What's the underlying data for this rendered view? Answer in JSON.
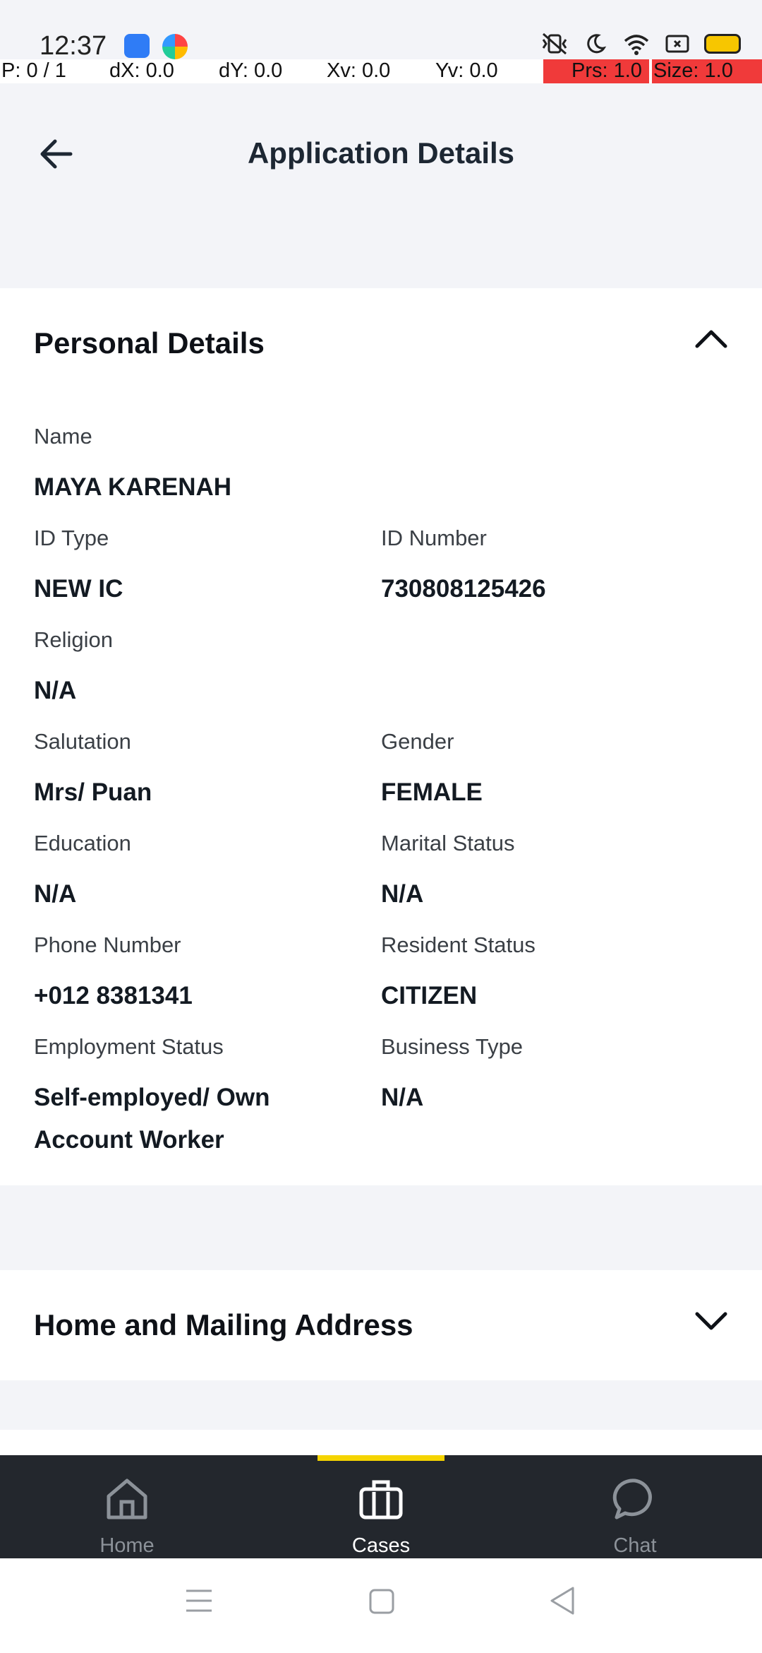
{
  "status_bar": {
    "time": "12:37",
    "icons": [
      "android-app-icon",
      "browser-app-icon",
      "vibrate-icon",
      "moon-icon",
      "wifi-icon",
      "screen-icon",
      "battery-icon"
    ]
  },
  "debug": {
    "pointer": "P: 0 / 1",
    "dx": "dX: 0.0",
    "dy": "dY: 0.0",
    "xv": "Xv: 0.0",
    "yv": "Yv: 0.0",
    "prs": "Prs: 1.0",
    "size": "Size: 1.0"
  },
  "header": {
    "title": "Application Details",
    "back_icon": "arrow-left-icon"
  },
  "personal": {
    "title": "Personal Details",
    "name": {
      "label": "Name",
      "value": "MAYA KARENAH"
    },
    "id_type": {
      "label": "ID Type",
      "value": "NEW IC"
    },
    "id_number": {
      "label": "ID Number",
      "value": "730808125426"
    },
    "religion": {
      "label": "Religion",
      "value": "N/A"
    },
    "salutation": {
      "label": "Salutation",
      "value": "Mrs/ Puan"
    },
    "gender": {
      "label": "Gender",
      "value": "FEMALE"
    },
    "education": {
      "label": "Education",
      "value": "N/A"
    },
    "marital": {
      "label": "Marital Status",
      "value": "N/A"
    },
    "phone": {
      "label": "Phone Number",
      "value": "+012 8381341"
    },
    "resident": {
      "label": "Resident Status",
      "value": "CITIZEN"
    },
    "employment": {
      "label": "Employment Status",
      "value": "Self-employed/ Own Account Worker"
    },
    "business": {
      "label": "Business Type",
      "value": "N/A"
    }
  },
  "address": {
    "title": "Home and Mailing Address"
  },
  "nav": {
    "home": "Home",
    "cases": "Cases",
    "chat": "Chat",
    "active": "Cases",
    "accent": "#F5D400"
  }
}
